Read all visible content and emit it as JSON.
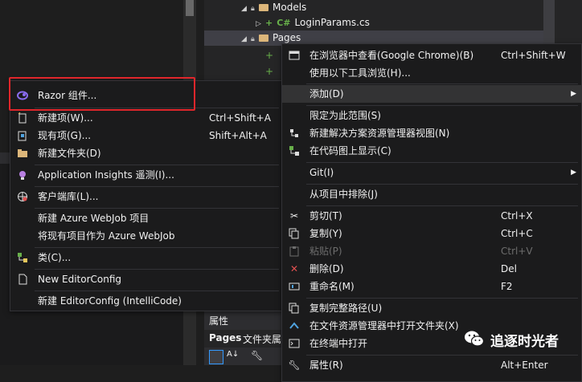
{
  "tree": {
    "rows": [
      {
        "label": "Models",
        "kind": "folder"
      },
      {
        "label": "LoginParams.cs",
        "kind": "cs"
      },
      {
        "label": "Pages",
        "kind": "folder",
        "selected": true
      }
    ],
    "cs_badge": "C#"
  },
  "properties": {
    "title": "属性",
    "subject": "Pages",
    "subject_type": "文件夹属"
  },
  "left_menu": {
    "items": [
      {
        "label": "Razor 组件...",
        "icon": "razor-icon",
        "shortcut": ""
      },
      {
        "label": "新建项(W)...",
        "icon": "new-item-icon",
        "shortcut": "Ctrl+Shift+A"
      },
      {
        "label": "现有项(G)...",
        "icon": "existing-item-icon",
        "shortcut": "Shift+Alt+A"
      },
      {
        "label": "新建文件夹(D)",
        "icon": "new-folder-icon",
        "shortcut": ""
      },
      {
        "label": "Application Insights 遥测(I)...",
        "icon": "insights-icon",
        "shortcut": ""
      },
      {
        "label": "客户端库(L)...",
        "icon": "client-library-icon",
        "shortcut": ""
      },
      {
        "label": "新建 Azure WebJob 项目",
        "icon": "",
        "shortcut": ""
      },
      {
        "label": "将现有项目作为 Azure WebJob",
        "icon": "",
        "shortcut": ""
      },
      {
        "label": "类(C)...",
        "icon": "class-icon",
        "shortcut": ""
      },
      {
        "label": "New EditorConfig",
        "icon": "editorconfig-icon",
        "shortcut": ""
      },
      {
        "label": "新建 EditorConfig (IntelliCode)",
        "icon": "",
        "shortcut": ""
      }
    ]
  },
  "right_menu": {
    "items": [
      {
        "label": "在浏览器中查看(Google Chrome)(B)",
        "shortcut": "Ctrl+Shift+W",
        "icon": "browser-icon"
      },
      {
        "label": "使用以下工具浏览(H)...",
        "shortcut": "",
        "icon": ""
      },
      {
        "label": "添加(D)",
        "shortcut": "",
        "icon": "",
        "submenu": true,
        "highlighted": true
      },
      {
        "label": "限定为此范围(S)",
        "shortcut": "",
        "icon": ""
      },
      {
        "label": "新建解决方案资源管理器视图(N)",
        "shortcut": "",
        "icon": "new-view-icon"
      },
      {
        "label": "在代码图上显示(C)",
        "shortcut": "",
        "icon": "code-map-icon"
      },
      {
        "label": "Git(I)",
        "shortcut": "",
        "icon": "",
        "submenu": true
      },
      {
        "label": "从项目中排除(J)",
        "shortcut": "",
        "icon": ""
      },
      {
        "label": "剪切(T)",
        "shortcut": "Ctrl+X",
        "icon": "cut-icon"
      },
      {
        "label": "复制(Y)",
        "shortcut": "Ctrl+C",
        "icon": "copy-icon"
      },
      {
        "label": "粘贴(P)",
        "shortcut": "Ctrl+V",
        "icon": "paste-icon",
        "disabled": true
      },
      {
        "label": "删除(D)",
        "shortcut": "Del",
        "icon": "delete-icon"
      },
      {
        "label": "重命名(M)",
        "shortcut": "F2",
        "icon": "rename-icon"
      },
      {
        "label": "复制完整路径(U)",
        "shortcut": "",
        "icon": "copy-path-icon"
      },
      {
        "label": "在文件资源管理器中打开文件夹(X)",
        "shortcut": "",
        "icon": "open-folder-icon"
      },
      {
        "label": "在终端中打开",
        "shortcut": "",
        "icon": "terminal-icon"
      },
      {
        "label": "属性(R)",
        "shortcut": "Alt+Enter",
        "icon": "properties-icon"
      }
    ]
  },
  "watermark": {
    "text": "追逐时光者"
  },
  "colors": {
    "highlight_box": "#e0262b",
    "razor_icon": "#8a6cf0"
  }
}
